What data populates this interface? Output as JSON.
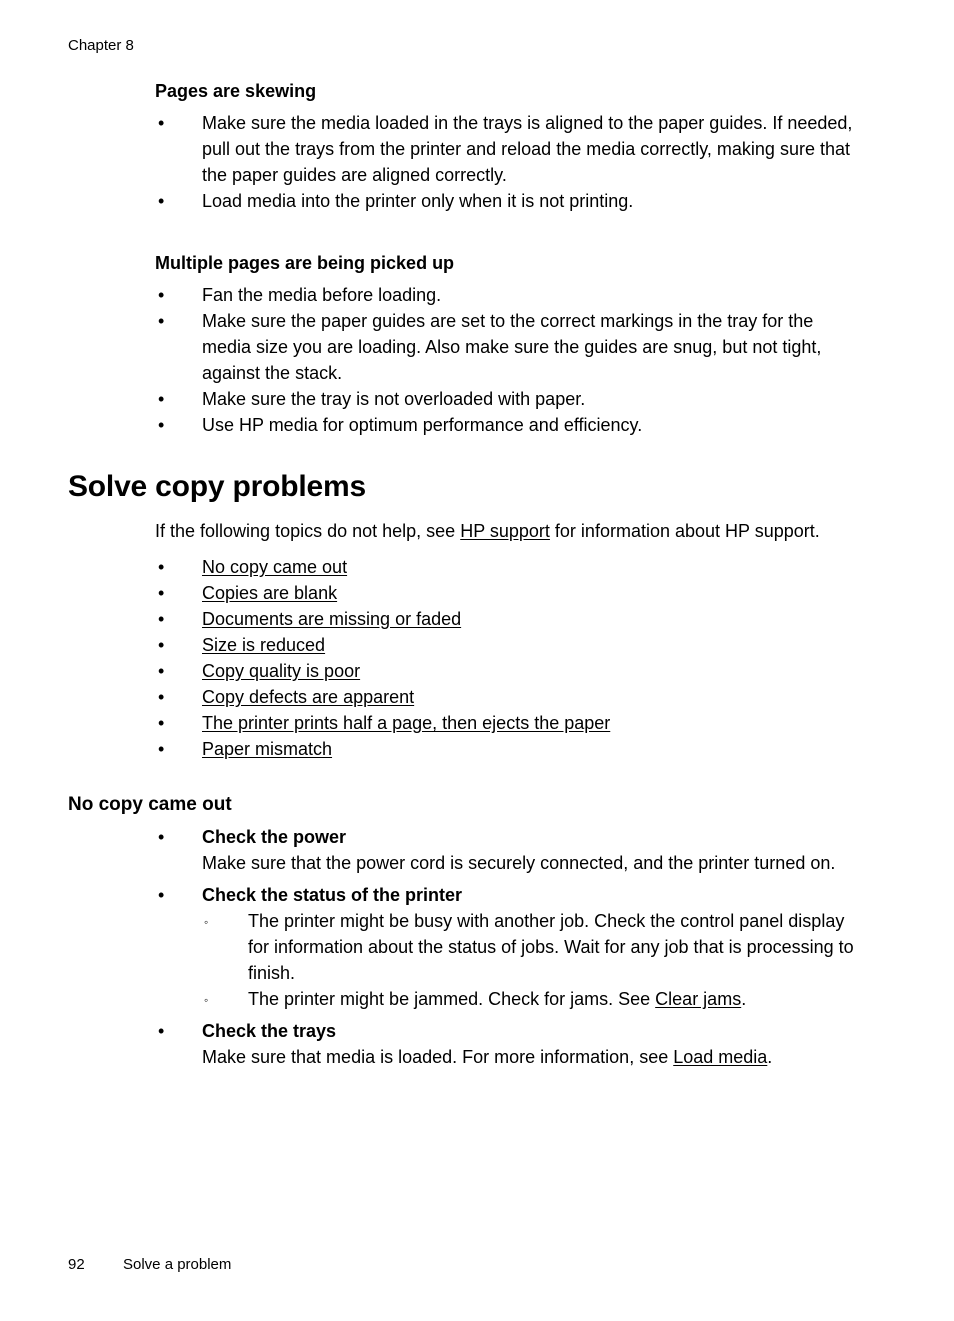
{
  "header": {
    "chapter_label": "Chapter 8"
  },
  "sections": {
    "pages_are_skewing": {
      "heading": "Pages are skewing",
      "bullets": [
        "Make sure the media loaded in the trays is aligned to the paper guides. If needed, pull out the trays from the printer and reload the media correctly, making sure that the paper guides are aligned correctly.",
        "Load media into the printer only when it is not printing."
      ]
    },
    "multiple_pages_picked_up": {
      "heading": "Multiple pages are being picked up",
      "bullets": [
        "Fan the media before loading.",
        "Make sure the paper guides are set to the correct markings in the tray for the media size you are loading. Also make sure the guides are snug, but not tight, against the stack.",
        "Make sure the tray is not overloaded with paper.",
        "Use HP media for optimum performance and efficiency."
      ]
    },
    "solve_copy_problems": {
      "title": "Solve copy problems",
      "intro_before_link": "If the following topics do not help, see ",
      "intro_link": "HP support",
      "intro_after_link": " for information about HP support.",
      "topic_links": [
        "No copy came out",
        "Copies are blank",
        "Documents are missing or faded",
        "Size is reduced",
        "Copy quality is poor",
        "Copy defects are apparent",
        "The printer prints half a page, then ejects the paper",
        "Paper mismatch"
      ]
    },
    "no_copy_came_out": {
      "heading": "No copy came out",
      "items": [
        {
          "term": "Check the power",
          "body": "Make sure that the power cord is securely connected, and the printer turned on."
        },
        {
          "term": "Check the status of the printer",
          "subbullets": [
            {
              "text": "The printer might be busy with another job. Check the control panel display for information about the status of jobs. Wait for any job that is processing to finish."
            },
            {
              "text_before_link": "The printer might be jammed. Check for jams. See ",
              "link": "Clear jams",
              "text_after_link": "."
            }
          ]
        },
        {
          "term": "Check the trays",
          "body_before_link": "Make sure that media is loaded. For more information, see ",
          "body_link": "Load media",
          "body_after_link": "."
        }
      ]
    }
  },
  "footer": {
    "page_number": "92",
    "title": "Solve a problem"
  },
  "glyphs": {
    "bullet": "•",
    "bullet_hollow": "◦"
  }
}
